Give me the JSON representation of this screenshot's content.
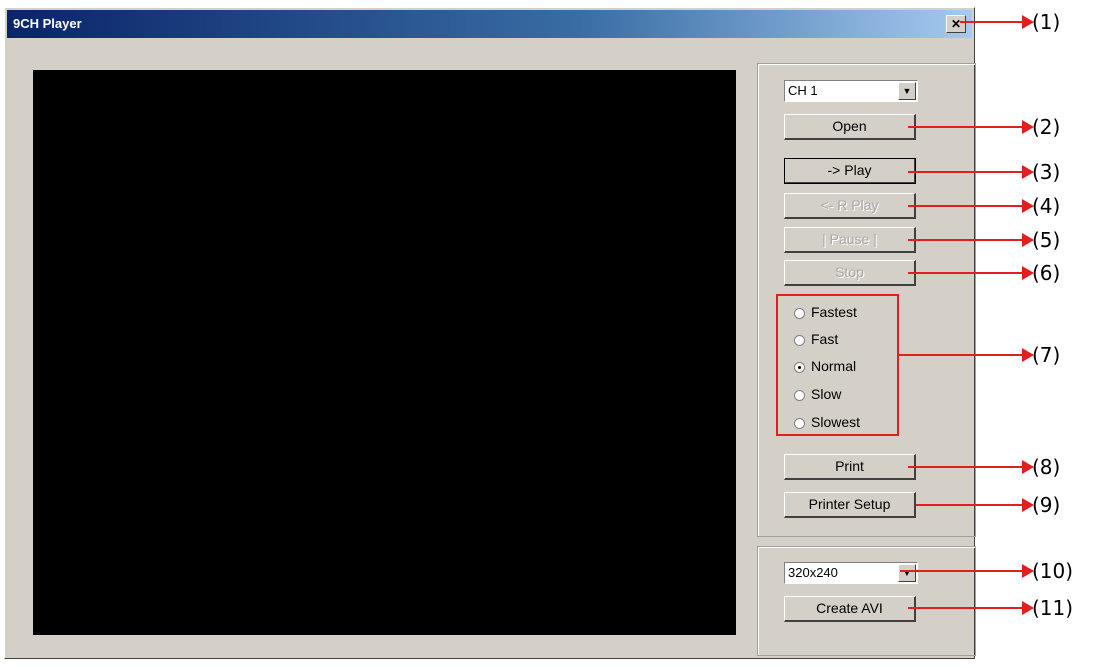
{
  "window": {
    "title": "9CH Player",
    "close_glyph": "✕"
  },
  "channel_select": {
    "value": "CH 1",
    "arrow_icon": "chevron-down-icon"
  },
  "buttons": {
    "open": "Open",
    "play": "-> Play",
    "reverse_play": "<- R Play",
    "pause": "| Pause |",
    "stop": "Stop",
    "print": "Print",
    "printer_setup": "Printer Setup",
    "create_avi": "Create AVI"
  },
  "speed_options": [
    {
      "label": "Fastest",
      "checked": false
    },
    {
      "label": "Fast",
      "checked": false
    },
    {
      "label": "Normal",
      "checked": true
    },
    {
      "label": "Slow",
      "checked": false
    },
    {
      "label": "Slowest",
      "checked": false
    }
  ],
  "resolution_select": {
    "value": "320x240"
  },
  "callouts": [
    "(1)",
    "(2)",
    "(3)",
    "(4)",
    "(5)",
    "(6)",
    "(7)",
    "(8)",
    "(9)",
    "(10)",
    "(11)"
  ],
  "colors": {
    "callout": "#e02020",
    "titlebar": "#0a246a",
    "face": "#d4d0c8"
  }
}
